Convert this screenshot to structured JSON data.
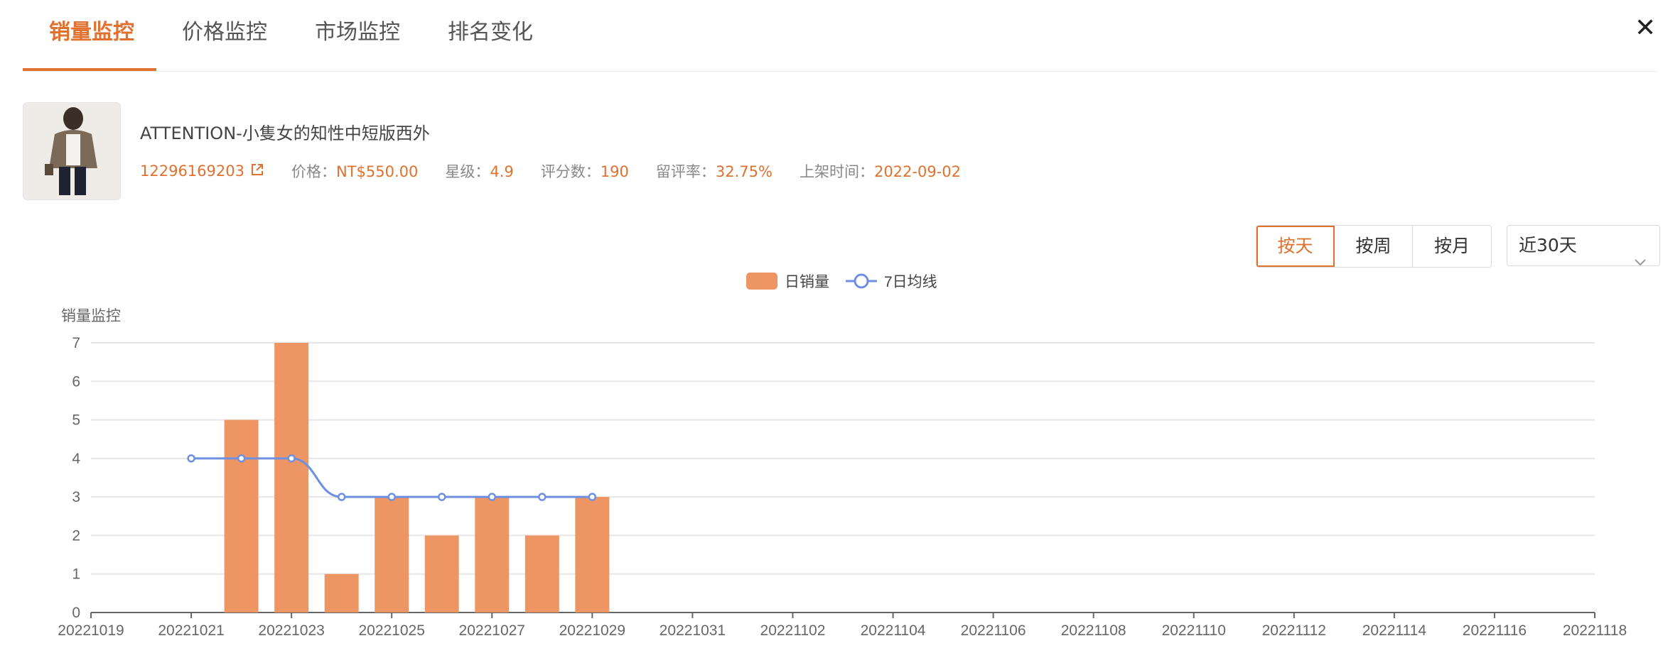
{
  "tabs": [
    {
      "label": "销量监控",
      "active": true
    },
    {
      "label": "价格监控",
      "active": false
    },
    {
      "label": "市场监控",
      "active": false
    },
    {
      "label": "排名变化",
      "active": false
    }
  ],
  "close_icon": "close-icon",
  "product": {
    "title": "ATTENTION-小隻女的知性中短版西外",
    "id": "12296169203",
    "price_label": "价格：",
    "price": "NT$550.00",
    "rating_label": "星级：",
    "rating": "4.9",
    "reviews_label": "评分数：",
    "reviews": "190",
    "review_rate_label": "留评率：",
    "review_rate": "32.75%",
    "listed_label": "上架时间：",
    "listed": "2022-09-02"
  },
  "period_buttons": [
    {
      "label": "按天",
      "active": true
    },
    {
      "label": "按周",
      "active": false
    },
    {
      "label": "按月",
      "active": false
    }
  ],
  "range_select": {
    "value": "近30天"
  },
  "colors": {
    "accent": "#e0712f",
    "bar": "#ee9663",
    "line": "#6f8fe0"
  },
  "chart_data": {
    "type": "bar",
    "ylabel": "销量监控",
    "ylim": [
      0,
      7
    ],
    "yticks": [
      0,
      1,
      2,
      3,
      4,
      5,
      6,
      7
    ],
    "grid": true,
    "legend_position": "top-center",
    "x": [
      "20221019",
      "20221020",
      "20221021",
      "20221022",
      "20221023",
      "20221024",
      "20221025",
      "20221026",
      "20221027",
      "20221028",
      "20221029",
      "20221030",
      "20221031",
      "20221101",
      "20221102",
      "20221103",
      "20221104",
      "20221105",
      "20221106",
      "20221107",
      "20221108",
      "20221109",
      "20221110",
      "20221111",
      "20221112",
      "20221113",
      "20221114",
      "20221115",
      "20221116",
      "20221117",
      "20221118"
    ],
    "xtick_labels": [
      "20221019",
      "20221021",
      "20221023",
      "20221025",
      "20221027",
      "20221029",
      "20221031",
      "20221102",
      "20221104",
      "20221106",
      "20221108",
      "20221110",
      "20221112",
      "20221114",
      "20221116",
      "20221118"
    ],
    "series": [
      {
        "name": "日销量",
        "type": "bar",
        "points": [
          {
            "x": "20221022",
            "y": 5
          },
          {
            "x": "20221023",
            "y": 7
          },
          {
            "x": "20221024",
            "y": 1
          },
          {
            "x": "20221025",
            "y": 3
          },
          {
            "x": "20221026",
            "y": 2
          },
          {
            "x": "20221027",
            "y": 3
          },
          {
            "x": "20221028",
            "y": 2
          },
          {
            "x": "20221029",
            "y": 3
          }
        ]
      },
      {
        "name": "7日均线",
        "type": "line",
        "points": [
          {
            "x": "20221021",
            "y": 4
          },
          {
            "x": "20221022",
            "y": 4
          },
          {
            "x": "20221023",
            "y": 4
          },
          {
            "x": "20221024",
            "y": 3
          },
          {
            "x": "20221025",
            "y": 3
          },
          {
            "x": "20221026",
            "y": 3
          },
          {
            "x": "20221027",
            "y": 3
          },
          {
            "x": "20221028",
            "y": 3
          },
          {
            "x": "20221029",
            "y": 3
          }
        ]
      }
    ]
  }
}
